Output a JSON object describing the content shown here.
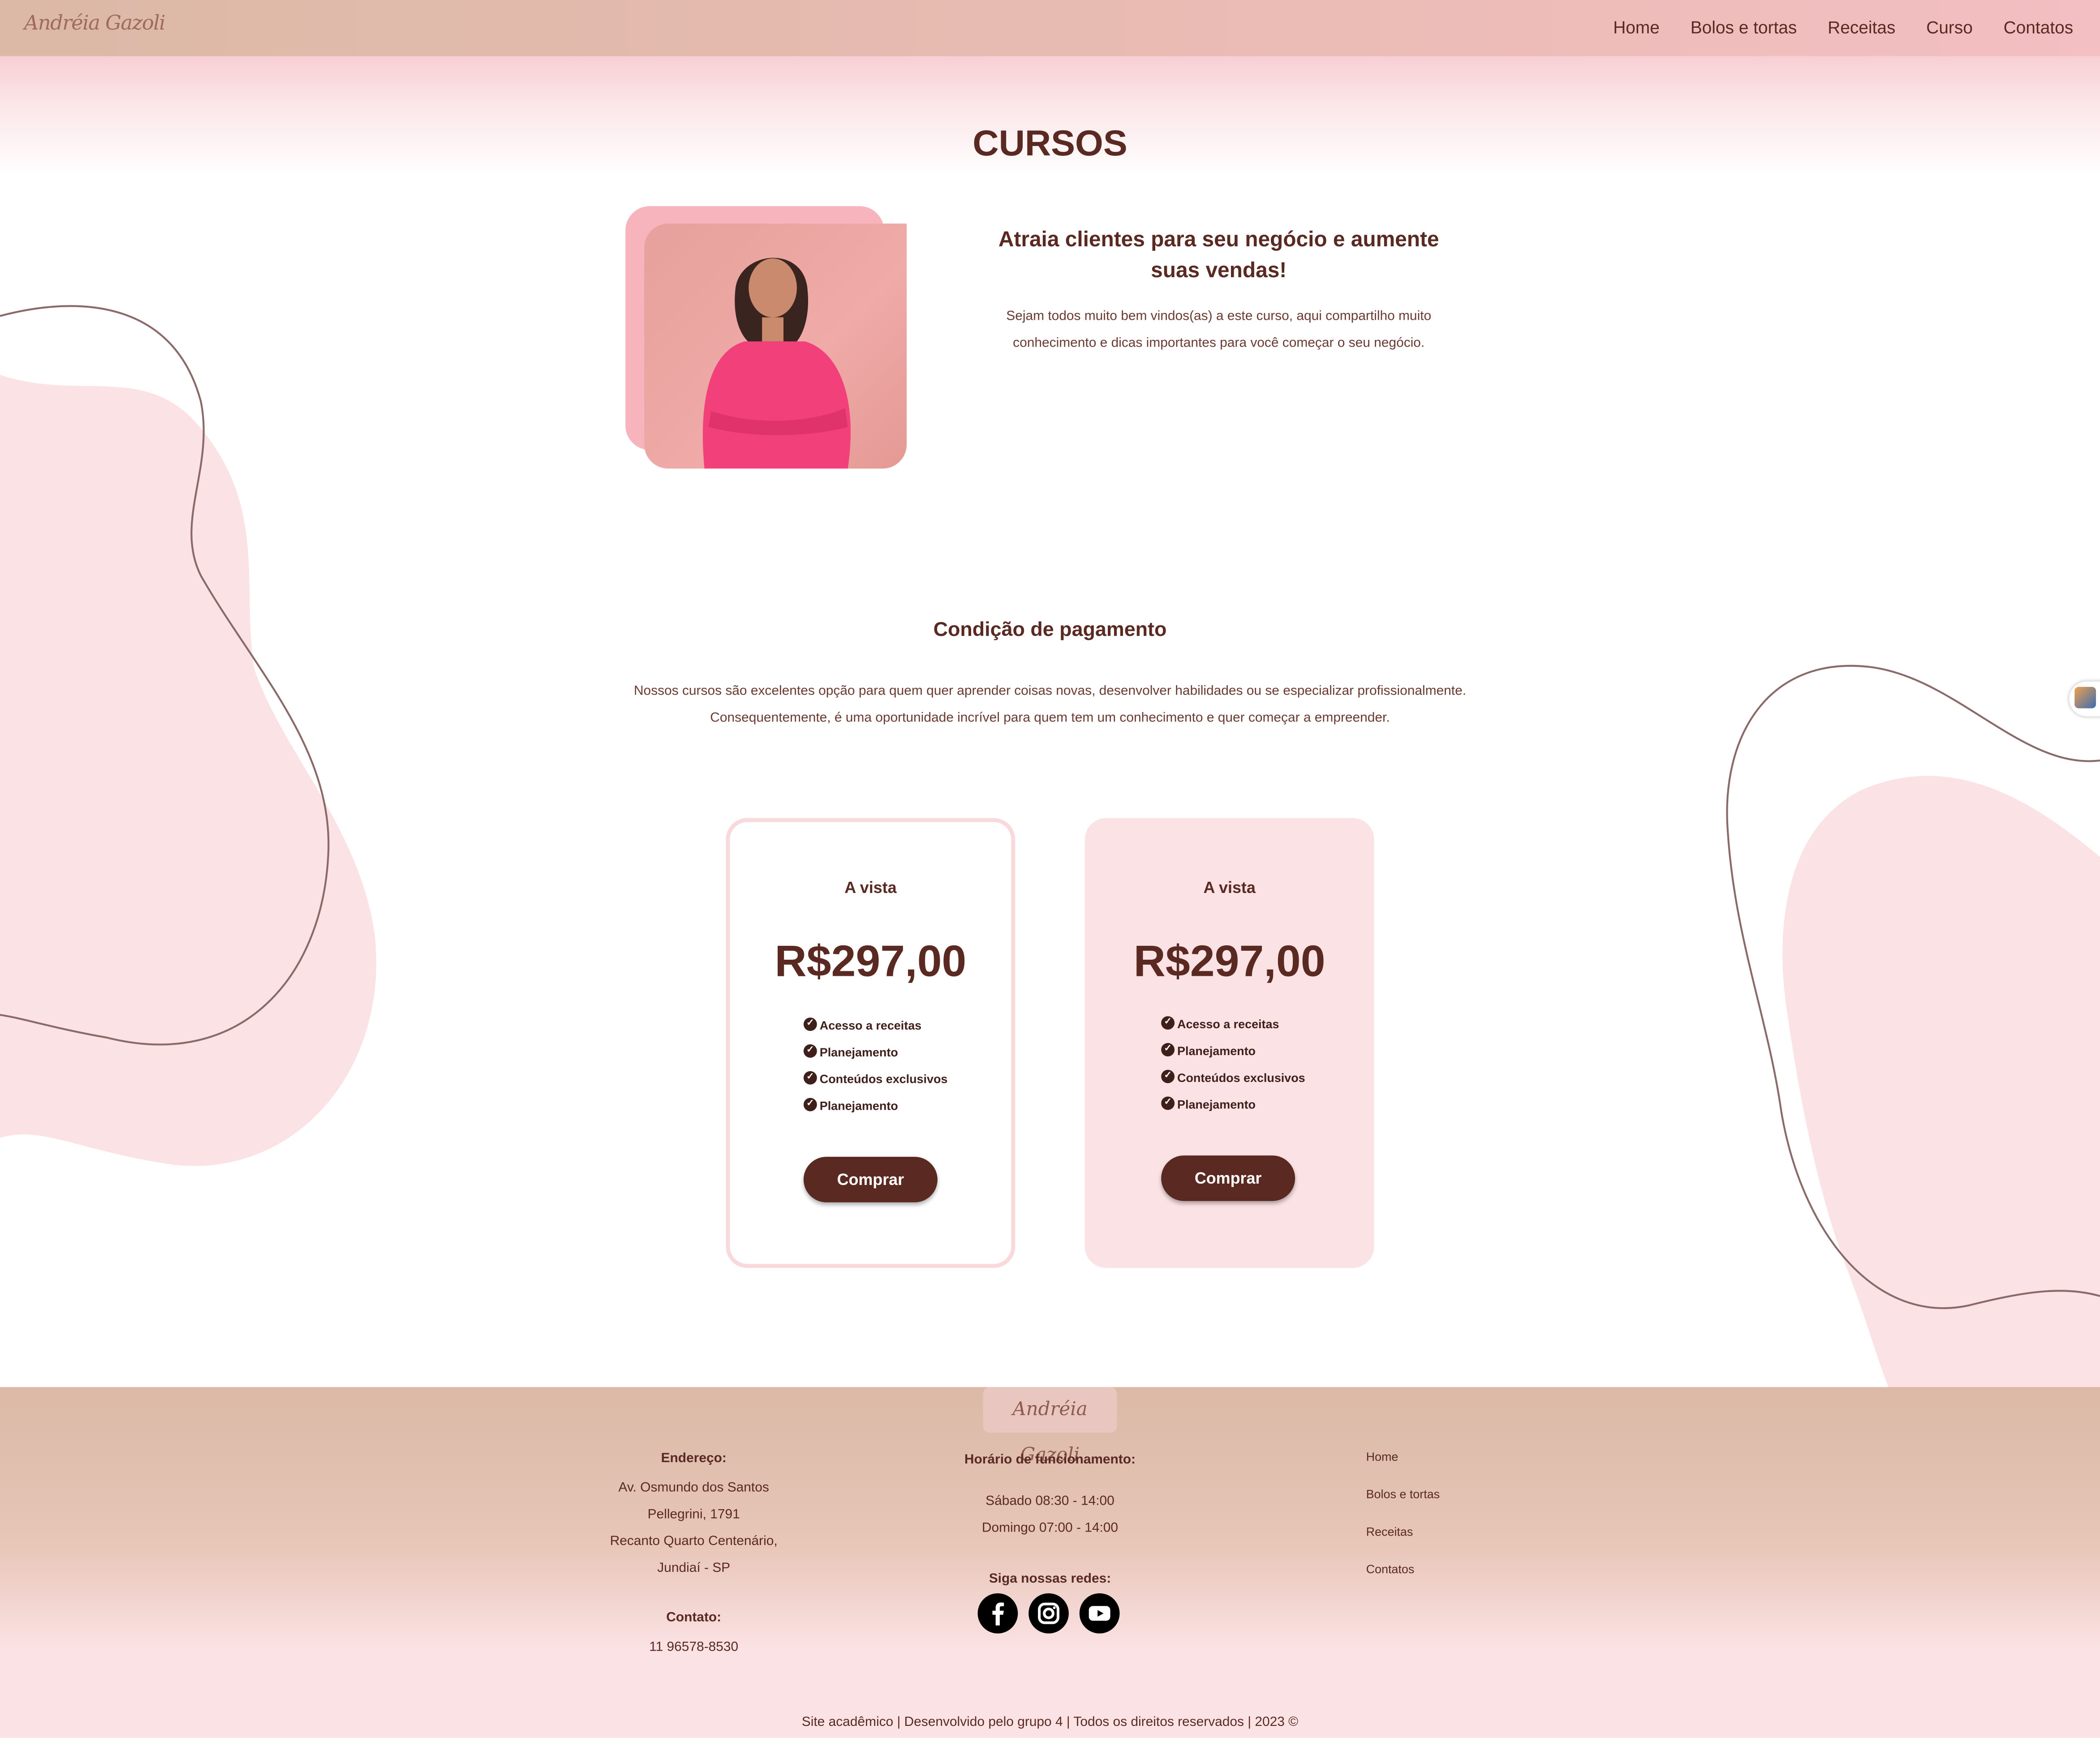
{
  "header": {
    "logo_text": "Andréia Gazoli",
    "nav": [
      "Home",
      "Bolos e tortas",
      "Receitas",
      "Curso",
      "Contatos"
    ]
  },
  "page_title": "CURSOS",
  "intro": {
    "heading": "Atraia clientes para seu negócio e aumente suas vendas!",
    "text": "Sejam todos muito bem vindos(as) a este curso, aqui compartilho muito conhecimento e dicas importantes para você começar o seu negócio."
  },
  "payment": {
    "heading": "Condição de pagamento",
    "text": "Nossos cursos são excelentes opção para quem quer aprender coisas novas, desenvolver habilidades ou se especializar profissionalmente. Consequentemente, é uma oportunidade incrível para quem tem um conhecimento e quer começar a empreender.",
    "cards": [
      {
        "label": "A vista",
        "price": "R$297,00",
        "features": [
          "Acesso a receitas",
          "Planejamento",
          "Conteúdos exclusivos",
          "Planejamento"
        ],
        "button": "Comprar"
      },
      {
        "label": "A vista",
        "price": "R$297,00",
        "features": [
          "Acesso a receitas",
          "Planejamento",
          "Conteúdos exclusivos",
          "Planejamento"
        ],
        "button": "Comprar"
      }
    ]
  },
  "footer": {
    "logo_text": "Andréia Gazoli",
    "address_title": "Endereço:",
    "address_lines": [
      "Av. Osmundo dos Santos",
      "Pellegrini, 1791",
      "Recanto Quarto Centenário,",
      "Jundiaí - SP"
    ],
    "contact_title": "Contato:",
    "phone": "11 96578-8530",
    "hours_title": "Horário de funcionamento:",
    "hours": [
      "Sábado 08:30 - 14:00",
      "Domingo 07:00 - 14:00"
    ],
    "social_title": "Siga nossas redes:",
    "social_icons": [
      "facebook-icon",
      "instagram-icon",
      "youtube-icon"
    ],
    "links": [
      "Home",
      "Bolos e tortas",
      "Receitas",
      "Contatos"
    ],
    "copyright": "Site acadêmico | Desenvolvido pelo grupo 4 | Todos os direitos reservados | 2023 ©"
  },
  "colors": {
    "accent": "#5a2a22",
    "pink": "#fbe2e4",
    "header_start": "#dbb9a6",
    "header_end": "#f3bfc2"
  }
}
